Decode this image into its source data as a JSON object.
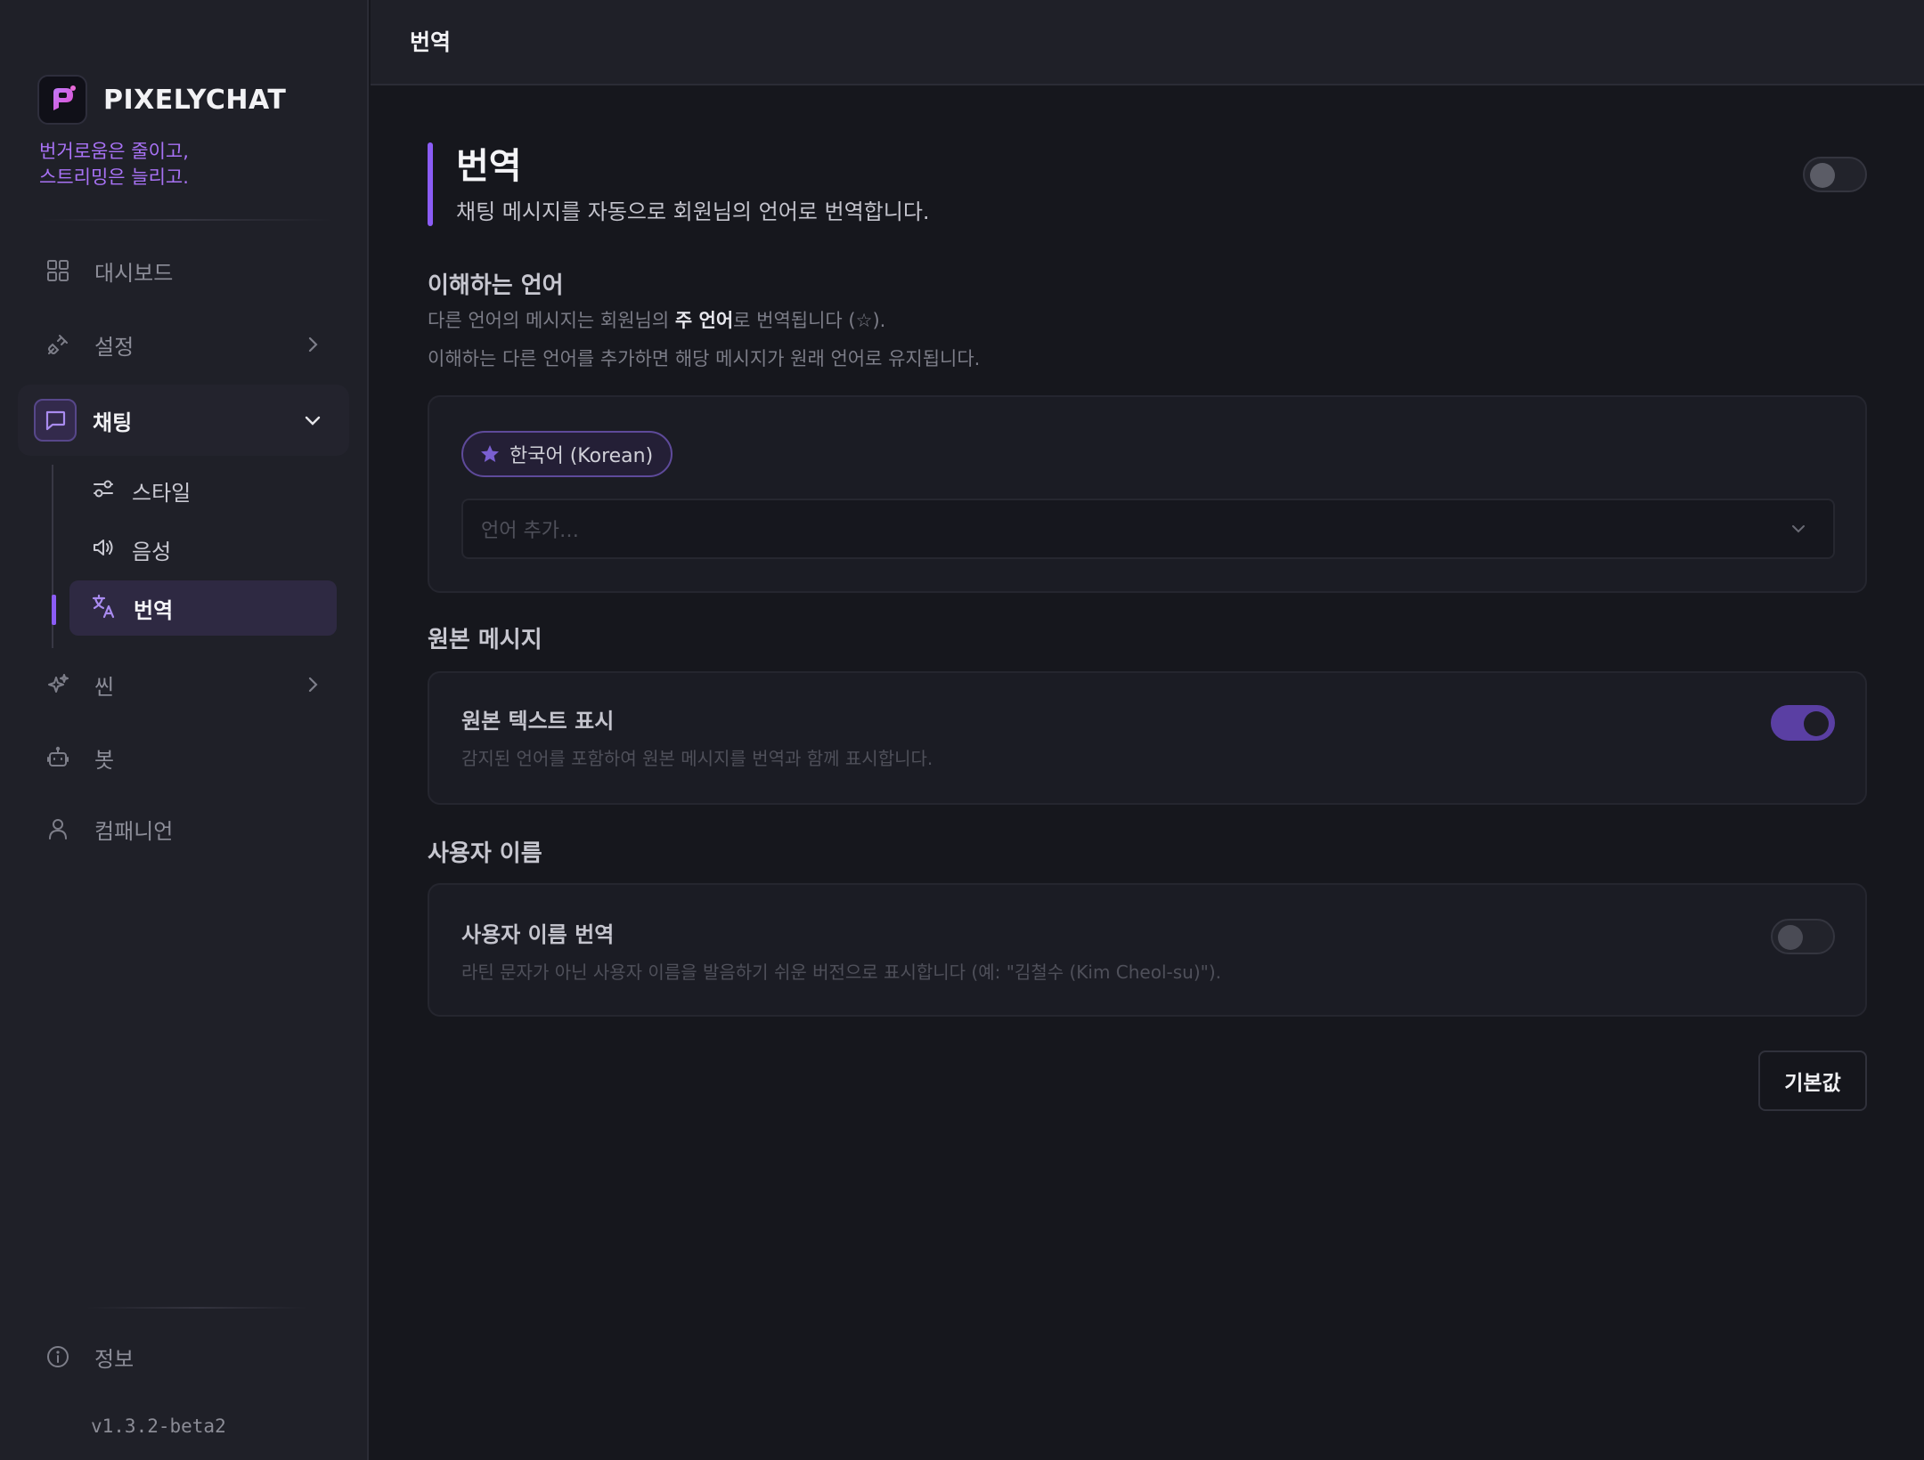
{
  "app": {
    "name": "PIXELYCHAT",
    "tagline_line1": "번거로움은 줄이고,",
    "tagline_line2": "스트리밍은 늘리고.",
    "version": "v1.3.2-beta2"
  },
  "sidebar": {
    "items": [
      {
        "label": "대시보드",
        "icon": "grid-icon"
      },
      {
        "label": "설정",
        "icon": "plug-icon"
      },
      {
        "label": "채팅",
        "icon": "chat-icon"
      },
      {
        "label": "씬",
        "icon": "sparkles-icon"
      },
      {
        "label": "봇",
        "icon": "robot-icon"
      },
      {
        "label": "컴패니언",
        "icon": "user-icon"
      }
    ],
    "chat_sub_items": [
      {
        "label": "스타일",
        "icon": "sliders-icon"
      },
      {
        "label": "음성",
        "icon": "speaker-icon"
      },
      {
        "label": "번역",
        "icon": "translate-icon"
      }
    ],
    "info_label": "정보"
  },
  "header": {
    "title": "번역"
  },
  "main": {
    "title": "번역",
    "subtitle": "채팅 메시지를 자동으로 회원님의 언어로 번역합니다.",
    "enabled": false,
    "languages": {
      "title": "이해하는 언어",
      "desc1_pre": "다른 언어의 메시지는 회원님의 ",
      "desc1_bold": "주 언어",
      "desc1_post": "로 번역됩니다 (☆).",
      "desc2": "이해하는 다른 언어를 추가하면 해당 메시지가 원래 언어로 유지됩니다.",
      "primary_language": "한국어 (Korean)",
      "add_placeholder": "언어 추가…"
    },
    "original": {
      "title": "원본 메시지",
      "row_title": "원본 텍스트 표시",
      "row_desc": "감지된 언어를 포함하여 원본 메시지를 번역과 함께 표시합니다.",
      "enabled": true
    },
    "username": {
      "title": "사용자 이름",
      "row_title": "사용자 이름 번역",
      "row_desc": "라틴 문자가 아닌 사용자 이름을 발음하기 쉬운 버전으로 표시합니다 (예: \"김철수 (Kim Cheol-su)\").",
      "enabled": false
    },
    "default_button": "기본값"
  },
  "colors": {
    "accent": "#8b5cf6",
    "tagline": "#a872f5",
    "background": "#16171d",
    "sidebar": "#1f2028"
  }
}
